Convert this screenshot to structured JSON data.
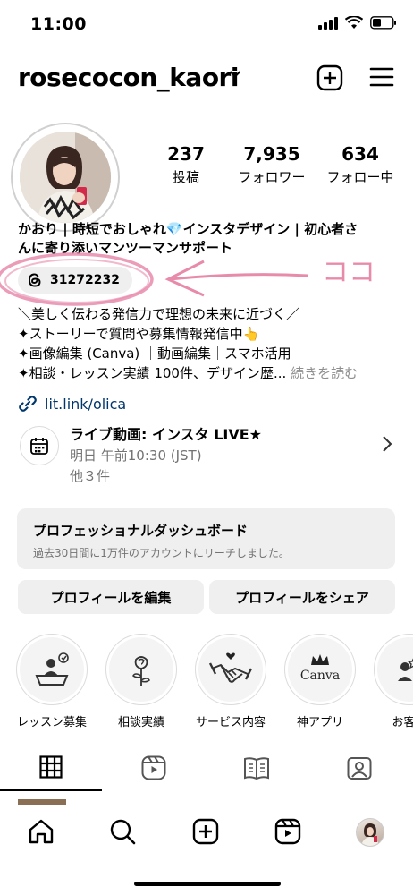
{
  "status": {
    "time": "11:00"
  },
  "header": {
    "username": "rosecocon_kaori"
  },
  "stats": [
    {
      "num": "237",
      "label": "投稿"
    },
    {
      "num": "7,935",
      "label": "フォロワー"
    },
    {
      "num": "634",
      "label": "フォロー中"
    }
  ],
  "bio": {
    "name_line1": "かおり | 時短でおしゃれ💎インスタデザイン | 初心者さ",
    "name_line2": "んに寄り添いマンツーマンサポート",
    "threads_count": "31272232",
    "annotation": "ココ",
    "lines": [
      "＼美しく伝わる発信力で理想の未来に近づく／",
      "✦ストーリーで質問や募集情報発信中👆",
      "✦画像編集 (Canva) ｜動画編集｜スマホ活用",
      "✦相談・レッスン実績 100件、デザイン歴..."
    ],
    "more": "続きを読む"
  },
  "link": {
    "text": "lit.link/olica"
  },
  "event": {
    "title": "ライブ動画: インスタ LIVE★",
    "time": "明日 午前10:30 (JST)",
    "more": "他３件"
  },
  "dashboard": {
    "title": "プロフェッショナルダッシュボード",
    "subtitle": "過去30日間に1万件のアカウントにリーチしました。"
  },
  "buttons": {
    "edit": "プロフィールを編集",
    "share": "プロフィールをシェア"
  },
  "highlights": [
    {
      "label": "レッスン募集",
      "icon": "lesson-icon"
    },
    {
      "label": "相談実績",
      "icon": "rose-icon"
    },
    {
      "label": "サービス内容",
      "icon": "handshake-icon"
    },
    {
      "label": "神アプリ",
      "icon": "canva-icon",
      "text": "Canva"
    },
    {
      "label": "お客様",
      "icon": "customer-icon"
    }
  ],
  "tabs": [
    "grid-icon",
    "reels-icon",
    "guide-icon",
    "tagged-icon"
  ],
  "bottom_nav": [
    "home-icon",
    "search-icon",
    "create-icon",
    "reels-icon",
    "profile-avatar"
  ]
}
